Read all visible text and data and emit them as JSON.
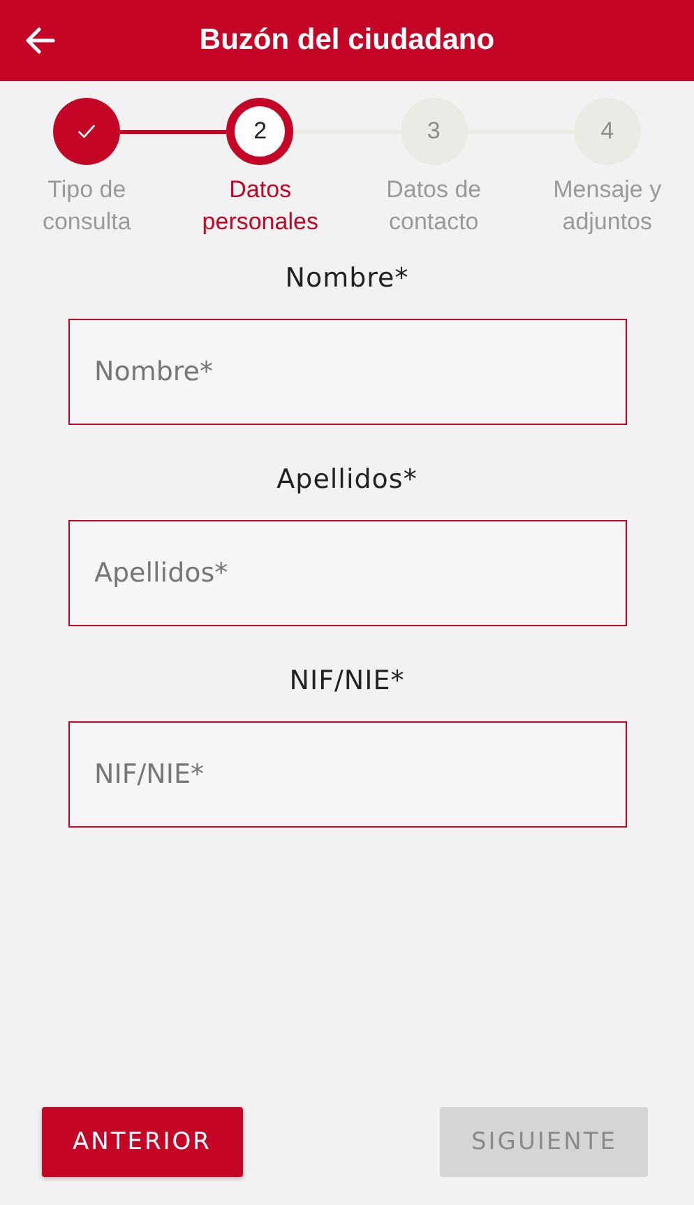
{
  "header": {
    "title": "Buzón del ciudadano"
  },
  "steps": [
    {
      "label": "Tipo de consulta",
      "completed": true,
      "selected": false
    },
    {
      "number": "2",
      "label": "Datos personales",
      "completed": false,
      "selected": true
    },
    {
      "number": "3",
      "label": "Datos de contacto",
      "completed": false,
      "selected": false
    },
    {
      "number": "4",
      "label": "Mensaje y adjuntos",
      "completed": false,
      "selected": false
    }
  ],
  "fields": [
    {
      "label": "Nombre*",
      "placeholder": "Nombre*"
    },
    {
      "label": "Apellidos*",
      "placeholder": "Apellidos*"
    },
    {
      "label": "NIF/NIE*",
      "placeholder": "NIF/NIE*"
    }
  ],
  "buttons": [
    {
      "label": "ANTERIOR",
      "disabled": false
    },
    {
      "label": "SIGUIENTE",
      "disabled": true
    }
  ]
}
